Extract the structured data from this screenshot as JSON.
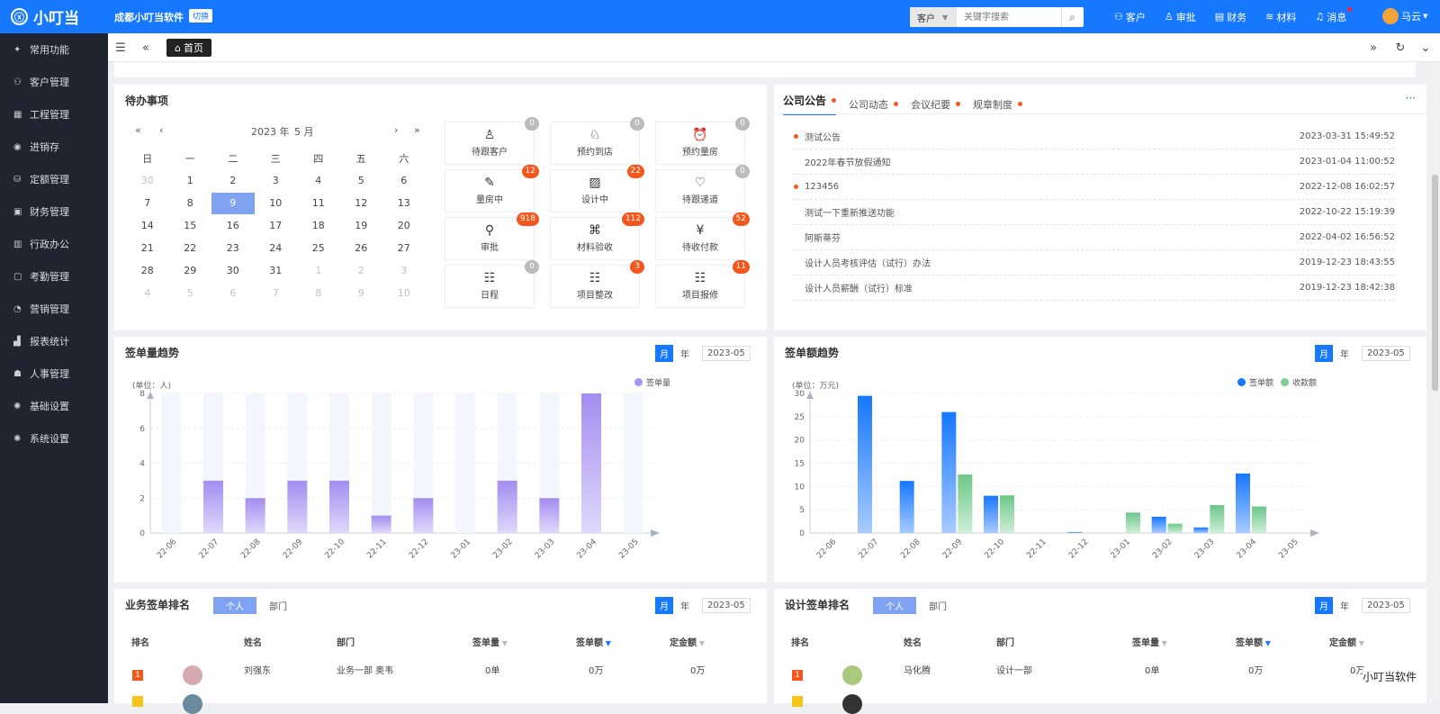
{
  "header": {
    "logo": "小叮当",
    "logo_icon": "ⓧ",
    "company": "成都小叮当软件",
    "switch": "切换",
    "search": {
      "select": "客户",
      "placeholder": "关键字搜索"
    },
    "nav": [
      {
        "icon": "user-icon",
        "label": "客户"
      },
      {
        "icon": "person-icon",
        "label": "审批"
      },
      {
        "icon": "finance-icon",
        "label": "财务"
      },
      {
        "icon": "stack-icon",
        "label": "材料"
      },
      {
        "icon": "bell-icon",
        "label": "消息"
      }
    ],
    "user": "马云"
  },
  "sidebar": [
    {
      "icon": "pin-icon",
      "label": "常用功能"
    },
    {
      "icon": "users-icon",
      "label": "客户管理"
    },
    {
      "icon": "building-icon",
      "label": "工程管理"
    },
    {
      "icon": "cycle-icon",
      "label": "进销存"
    },
    {
      "icon": "database-icon",
      "label": "定额管理"
    },
    {
      "icon": "money-icon",
      "label": "财务管理"
    },
    {
      "icon": "office-icon",
      "label": "行政办公"
    },
    {
      "icon": "calendar-icon",
      "label": "考勤管理"
    },
    {
      "icon": "chart-pie-icon",
      "label": "营销管理"
    },
    {
      "icon": "bar-icon",
      "label": "报表统计"
    },
    {
      "icon": "hr-icon",
      "label": "人事管理"
    },
    {
      "icon": "gear-icon",
      "label": "基础设置"
    },
    {
      "icon": "gear2-icon",
      "label": "系统设置"
    }
  ],
  "tabs": {
    "home": "首页"
  },
  "todo": {
    "title": "待办事项",
    "year": "2023 年",
    "month": "5 月",
    "weekdays": [
      "日",
      "一",
      "二",
      "三",
      "四",
      "五",
      "六"
    ],
    "weeks": [
      [
        "30",
        "1",
        "2",
        "3",
        "4",
        "5",
        "6"
      ],
      [
        "7",
        "8",
        "9",
        "10",
        "11",
        "12",
        "13"
      ],
      [
        "14",
        "15",
        "16",
        "17",
        "18",
        "19",
        "20"
      ],
      [
        "21",
        "22",
        "23",
        "24",
        "25",
        "26",
        "27"
      ],
      [
        "28",
        "29",
        "30",
        "31",
        "1",
        "2",
        "3"
      ],
      [
        "4",
        "5",
        "6",
        "7",
        "8",
        "9",
        "10"
      ]
    ],
    "tiles": [
      {
        "label": "待跟客户",
        "count": "0",
        "icon": "person-outline-icon"
      },
      {
        "label": "预约到店",
        "count": "0",
        "icon": "person-clock-icon"
      },
      {
        "label": "预约量房",
        "count": "0",
        "icon": "alarm-icon"
      },
      {
        "label": "量房中",
        "count": "12",
        "icon": "person-edit-icon"
      },
      {
        "label": "设计中",
        "count": "22",
        "icon": "image-icon"
      },
      {
        "label": "待跟递道",
        "count": "0",
        "icon": "heart-icon"
      },
      {
        "label": "审批",
        "count": "918",
        "icon": "stamp-icon"
      },
      {
        "label": "材料验收",
        "count": "112",
        "icon": "book-icon"
      },
      {
        "label": "待收付款",
        "count": "52",
        "icon": "invoice-icon"
      },
      {
        "label": "日程",
        "count": "0",
        "icon": "list-icon"
      },
      {
        "label": "项目整改",
        "count": "3",
        "icon": "list-icon"
      },
      {
        "label": "项目报修",
        "count": "11",
        "icon": "list-icon"
      }
    ]
  },
  "notice": {
    "tabs": [
      "公司公告",
      "公司动态",
      "会议纪要",
      "规章制度"
    ],
    "more": "···",
    "items": [
      {
        "title": "测试公告",
        "date": "2023-03-31 15:49:52",
        "dot": true
      },
      {
        "title": "2022年春节放假通知",
        "date": "2023-01-04 11:00:52",
        "dot": false
      },
      {
        "title": "123456",
        "date": "2022-12-08 16:02:57",
        "dot": true
      },
      {
        "title": "测试一下重新推送功能",
        "date": "2022-10-22 15:19:39",
        "dot": false
      },
      {
        "title": "阿斯蒂芬",
        "date": "2022-04-02 16:56:52",
        "dot": false
      },
      {
        "title": "设计人员考核评估（试行）办法",
        "date": "2019-12-23 18:43:55",
        "dot": false
      },
      {
        "title": "设计人员薪酬（试行）标准",
        "date": "2019-12-23 18:42:38",
        "dot": false
      }
    ]
  },
  "trend_count": {
    "title": "签单量趋势",
    "month": "月",
    "year": "年",
    "date": "2023-05",
    "unit": "(单位：人)",
    "legend": "签单量"
  },
  "trend_amount": {
    "title": "签单额趋势",
    "month": "月",
    "year": "年",
    "date": "2023-05",
    "unit": "(单位：万元)",
    "legend1": "签单额",
    "legend2": "收款额"
  },
  "chart_data": [
    {
      "type": "bar",
      "categories": [
        "22-06",
        "22-07",
        "22-08",
        "22-09",
        "22-10",
        "22-11",
        "22-12",
        "23-01",
        "23-02",
        "23-03",
        "23-04",
        "23-05"
      ],
      "series": [
        {
          "name": "签单量",
          "values": [
            0,
            3,
            2,
            3,
            3,
            1,
            2,
            0,
            3,
            2,
            8,
            0
          ]
        }
      ],
      "ylim": [
        0,
        8
      ],
      "yticks": [
        0,
        2,
        4,
        6,
        8
      ]
    },
    {
      "type": "bar",
      "categories": [
        "22-06",
        "22-07",
        "22-08",
        "22-09",
        "22-10",
        "22-11",
        "22-12",
        "23-01",
        "23-02",
        "23-03",
        "23-04",
        "23-05"
      ],
      "series": [
        {
          "name": "签单额",
          "values": [
            0,
            29.5,
            11.2,
            26,
            8,
            0,
            0.2,
            0,
            3.5,
            1.2,
            12.8,
            0
          ]
        },
        {
          "name": "收款额",
          "values": [
            0,
            0,
            0,
            12.6,
            8.1,
            0,
            0,
            4.4,
            2,
            6,
            5.7,
            0
          ]
        }
      ],
      "ylim": [
        0,
        30
      ],
      "yticks": [
        0,
        5,
        10,
        15,
        20,
        25,
        30
      ]
    }
  ],
  "biz_rank": {
    "title": "业务签单排名",
    "tab1": "个人",
    "tab2": "部门",
    "month": "月",
    "year": "年",
    "date": "2023-05",
    "cols": [
      "排名",
      "姓名",
      "部门",
      "签单量",
      "签单额",
      "定金额"
    ],
    "row": {
      "rank": "1",
      "name": "刘强东",
      "dept": "业务一部 奥韦",
      "count": "0单",
      "amount": "0万",
      "deposit": "0万"
    }
  },
  "design_rank": {
    "title": "设计签单排名",
    "tab1": "个人",
    "tab2": "部门",
    "month": "月",
    "year": "年",
    "date": "2023-05",
    "cols": [
      "排名",
      "姓名",
      "部门",
      "签单量",
      "签单额",
      "定金额"
    ],
    "row": {
      "rank": "1",
      "name": "马化腾",
      "dept": "设计一部",
      "count": "0单",
      "amount": "0万",
      "deposit": "0万"
    }
  },
  "watermark": "小叮当软件"
}
